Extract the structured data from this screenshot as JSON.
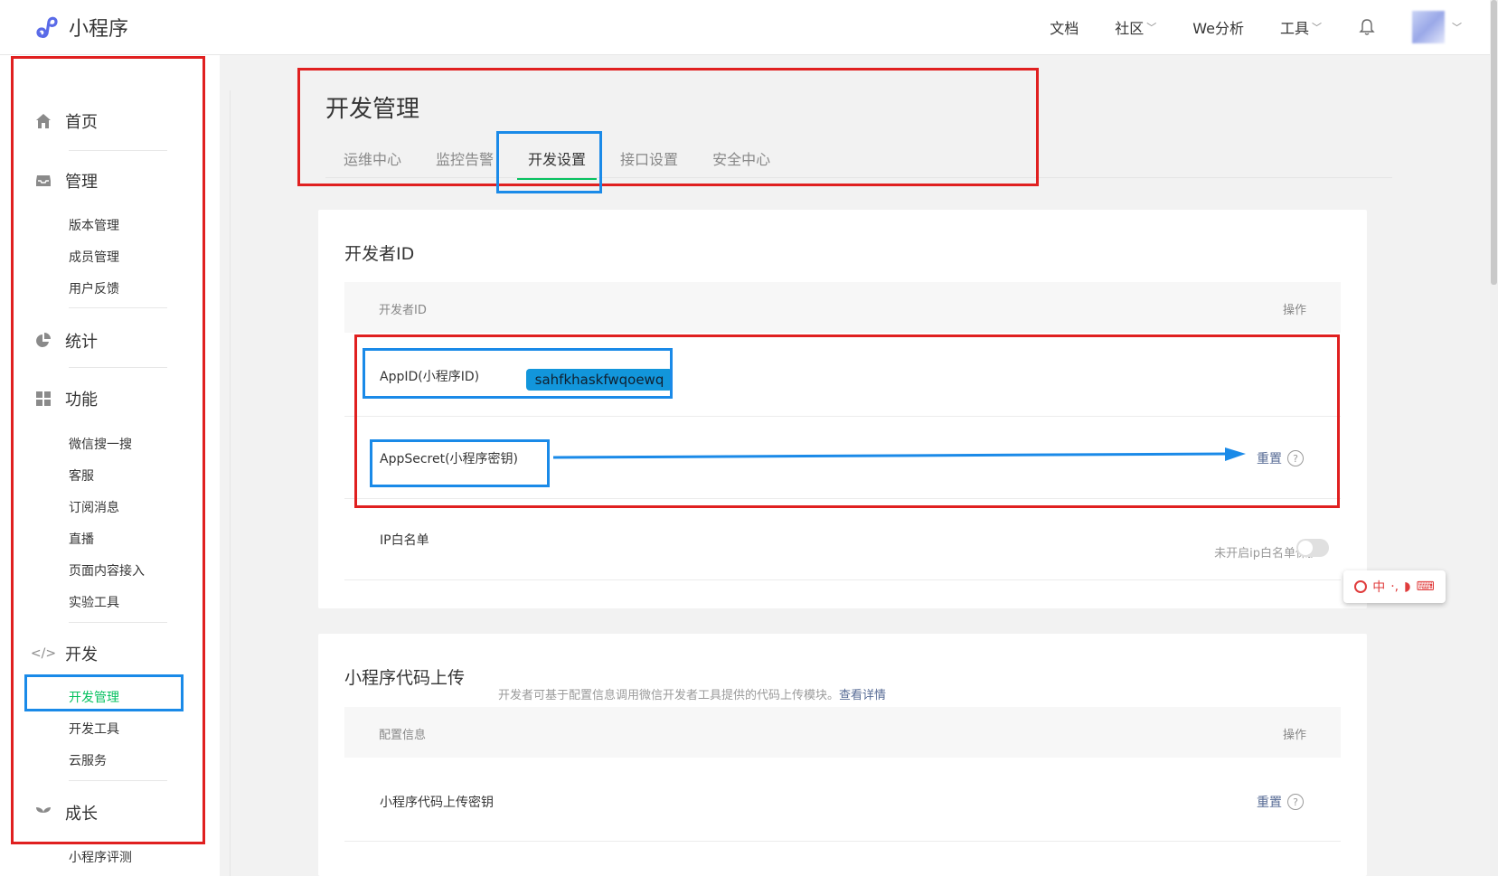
{
  "app": {
    "name": "小程序"
  },
  "topnav": {
    "docs": "文档",
    "community": "社区",
    "analytics": "We分析",
    "tools": "工具"
  },
  "sidebar": {
    "home": "首页",
    "manage": {
      "label": "管理",
      "items": [
        "版本管理",
        "成员管理",
        "用户反馈"
      ]
    },
    "stats": "统计",
    "features": {
      "label": "功能",
      "items": [
        "微信搜一搜",
        "客服",
        "订阅消息",
        "直播",
        "页面内容接入",
        "实验工具"
      ]
    },
    "dev": {
      "label": "开发",
      "items": [
        "开发管理",
        "开发工具",
        "云服务"
      ],
      "active": "开发管理"
    },
    "growth": {
      "label": "成长",
      "partial_item": "小程序评测"
    }
  },
  "page": {
    "title": "开发管理",
    "tabs": [
      "运维中心",
      "监控告警",
      "开发设置",
      "接口设置",
      "安全中心"
    ],
    "active_tab": "开发设置"
  },
  "dev_id_card": {
    "title": "开发者ID",
    "col_name": "开发者ID",
    "col_action": "操作",
    "appid_label": "AppID(小程序ID)",
    "appid_value": "sahfkhaskfwqoewq",
    "secret_label": "AppSecret(小程序密钥)",
    "reset": "重置",
    "help": "?",
    "ip_label": "IP白名单",
    "ip_status": "未开启ip白名单保护",
    "ip_enabled": false
  },
  "upload_card": {
    "title": "小程序代码上传",
    "desc": "开发者可基于配置信息调用微信开发者工具提供的代码上传模块。",
    "desc_link": "查看详情",
    "col_name": "配置信息",
    "col_action": "操作",
    "key_label": "小程序代码上传密钥",
    "reset": "重置",
    "help": "?"
  },
  "ime": {
    "mode": "中"
  },
  "colors": {
    "accent_green": "#07c160",
    "link": "#576b95",
    "annotation_red": "#e02020",
    "annotation_blue": "#1a8ae8"
  }
}
